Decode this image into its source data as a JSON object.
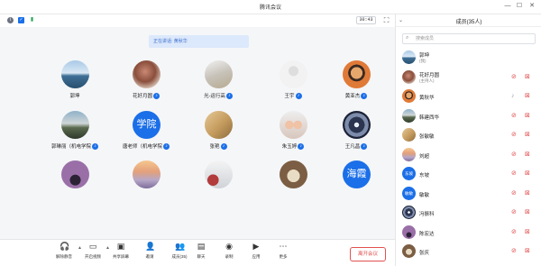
{
  "window": {
    "title": "腾讯会议"
  },
  "info": {
    "timer": "30:43"
  },
  "stage": {
    "speaker_text": "正在讲话: 黄秋华",
    "participants": [
      {
        "name": "郭坤",
        "mic": false,
        "style": "sea"
      },
      {
        "name": "花好月圆",
        "mic": true,
        "style": "tree"
      },
      {
        "name": "光-运行高",
        "mic": true,
        "style": "mountain"
      },
      {
        "name": "王宇",
        "mic": true,
        "style": "gray"
      },
      {
        "name": "黄亚杰",
        "mic": true,
        "style": "person"
      },
      {
        "name": "郭琳丽（机电学院",
        "mic": true,
        "style": "lake"
      },
      {
        "name": "唐老师（机电学院",
        "mic": true,
        "style": "text",
        "text": "学院"
      },
      {
        "name": "张艳",
        "mic": true,
        "style": "sand"
      },
      {
        "name": "朱玉婷",
        "mic": true,
        "style": "couple"
      },
      {
        "name": "王凡昌",
        "mic": true,
        "style": "disc"
      },
      {
        "name": "",
        "mic": false,
        "style": "purple"
      },
      {
        "name": "",
        "mic": false,
        "style": "sunset"
      },
      {
        "name": "",
        "mic": false,
        "style": "car"
      },
      {
        "name": "",
        "mic": false,
        "style": "cake"
      },
      {
        "name": "",
        "mic": false,
        "style": "text",
        "text": "海霞"
      }
    ]
  },
  "toolbar": {
    "buttons": [
      {
        "label": "解除静音",
        "icon": "headset-icon",
        "glyph": "🎧"
      },
      {
        "label": "开启视频",
        "icon": "video-icon",
        "glyph": "▭"
      },
      {
        "label": "共享屏幕",
        "icon": "share-screen-icon",
        "glyph": "▣"
      },
      {
        "label": "邀请",
        "icon": "invite-icon",
        "glyph": "👤"
      },
      {
        "label": "成员(35)",
        "icon": "members-icon",
        "glyph": "👥"
      },
      {
        "label": "聊天",
        "icon": "chat-icon",
        "glyph": "▤"
      },
      {
        "label": "录制",
        "icon": "record-icon",
        "glyph": "◉"
      },
      {
        "label": "应用",
        "icon": "apps-icon",
        "glyph": "▶"
      },
      {
        "label": "更多",
        "icon": "more-icon",
        "glyph": "⋯"
      }
    ],
    "end_label": "离开会议"
  },
  "panel": {
    "title": "成员(35人)",
    "search_placeholder": "搜索成员",
    "members": [
      {
        "name": "郭坤",
        "role": "(我)",
        "style": "sea",
        "mic_on": false,
        "cam": false
      },
      {
        "name": "花好月圆",
        "role": "(主持人)",
        "style": "tree",
        "mic_on": false,
        "cam": true
      },
      {
        "name": "黄秋华",
        "role": "",
        "style": "person",
        "mic_on": true,
        "cam": true
      },
      {
        "name": "韩建西华",
        "role": "",
        "style": "lake",
        "mic_on": false,
        "cam": true
      },
      {
        "name": "张敏敏",
        "role": "",
        "style": "sand",
        "mic_on": false,
        "cam": true
      },
      {
        "name": "刘超",
        "role": "",
        "style": "sunset",
        "mic_on": false,
        "cam": true
      },
      {
        "name": "东坡",
        "role": "",
        "style": "text",
        "text": "东坡",
        "mic_on": false,
        "cam": true
      },
      {
        "name": "敏敏",
        "role": "",
        "style": "text",
        "text": "敏敏",
        "mic_on": false,
        "cam": true
      },
      {
        "name": "冯振科",
        "role": "",
        "style": "disc",
        "mic_on": false,
        "cam": true
      },
      {
        "name": "陈宏达",
        "role": "",
        "style": "purple",
        "mic_on": false,
        "cam": true
      },
      {
        "name": "张庆",
        "role": "",
        "style": "cake",
        "mic_on": false,
        "cam": true
      }
    ]
  },
  "colors": {
    "accent": "#1b6fe8",
    "danger": "#e35050",
    "panel_bg": "#ffffff",
    "stage_bg": "#f5f6f8"
  }
}
